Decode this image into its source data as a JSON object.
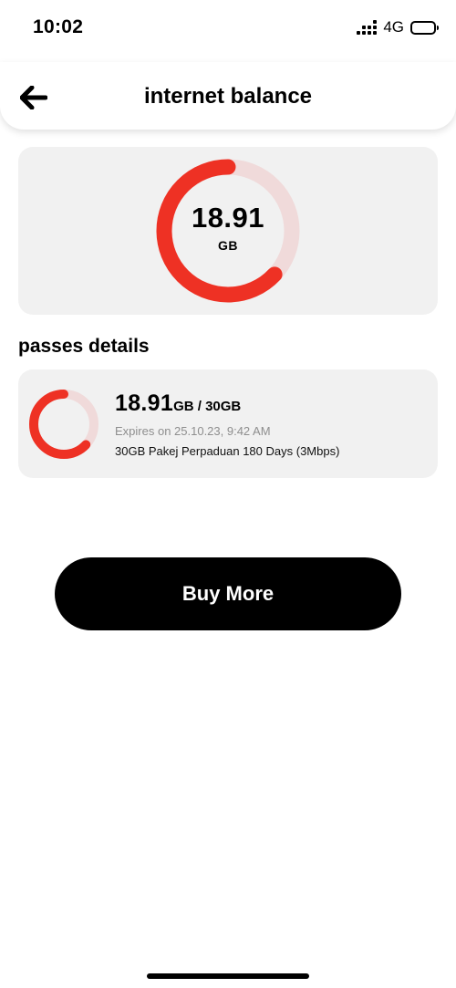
{
  "status_bar": {
    "time": "10:02",
    "network": "4G",
    "icons": [
      "signal-icon",
      "battery-icon"
    ]
  },
  "header": {
    "title": "internet balance",
    "back_icon": "arrow-left-icon"
  },
  "balance": {
    "value": "18.91",
    "unit": "GB",
    "remaining_fraction": 0.63
  },
  "passes": {
    "title": "passes details",
    "items": [
      {
        "used": "18.91",
        "used_unit": "GB",
        "separator": " / ",
        "total": "30GB",
        "expiry": "Expires on 25.10.23, 9:42 AM",
        "name": "30GB Pakej Perpaduan 180 Days (3Mbps)",
        "remaining_fraction": 0.63
      }
    ]
  },
  "actions": {
    "buy_more_label": "Buy More"
  },
  "colors": {
    "accent": "#ee3124",
    "ring_track": "#f0dada",
    "card_bg": "#f1f1f1",
    "button_bg": "#000000"
  }
}
